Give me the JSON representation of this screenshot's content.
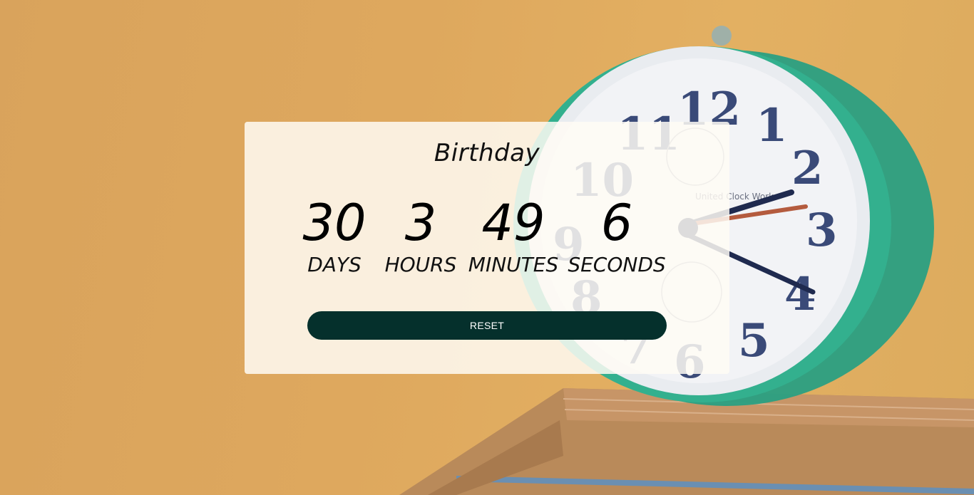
{
  "event": {
    "title": "Birthday"
  },
  "countdown": [
    {
      "value": "30",
      "label": "DAYS"
    },
    {
      "value": "3",
      "label": "HOURS"
    },
    {
      "value": "49",
      "label": "MINUTES"
    },
    {
      "value": "6",
      "label": "SECONDS"
    }
  ],
  "actions": {
    "reset_label": "RESET"
  },
  "colors": {
    "background": "#dea85e",
    "card": "#fdf6ec",
    "button": "#05302c",
    "button_text": "#ffffff",
    "clock_body": "#2aa584"
  },
  "clock_face": {
    "numerals": [
      "12",
      "1",
      "2",
      "3",
      "4",
      "5",
      "6",
      "7",
      "8",
      "9",
      "10",
      "11"
    ],
    "maker": "United Clock Works"
  }
}
